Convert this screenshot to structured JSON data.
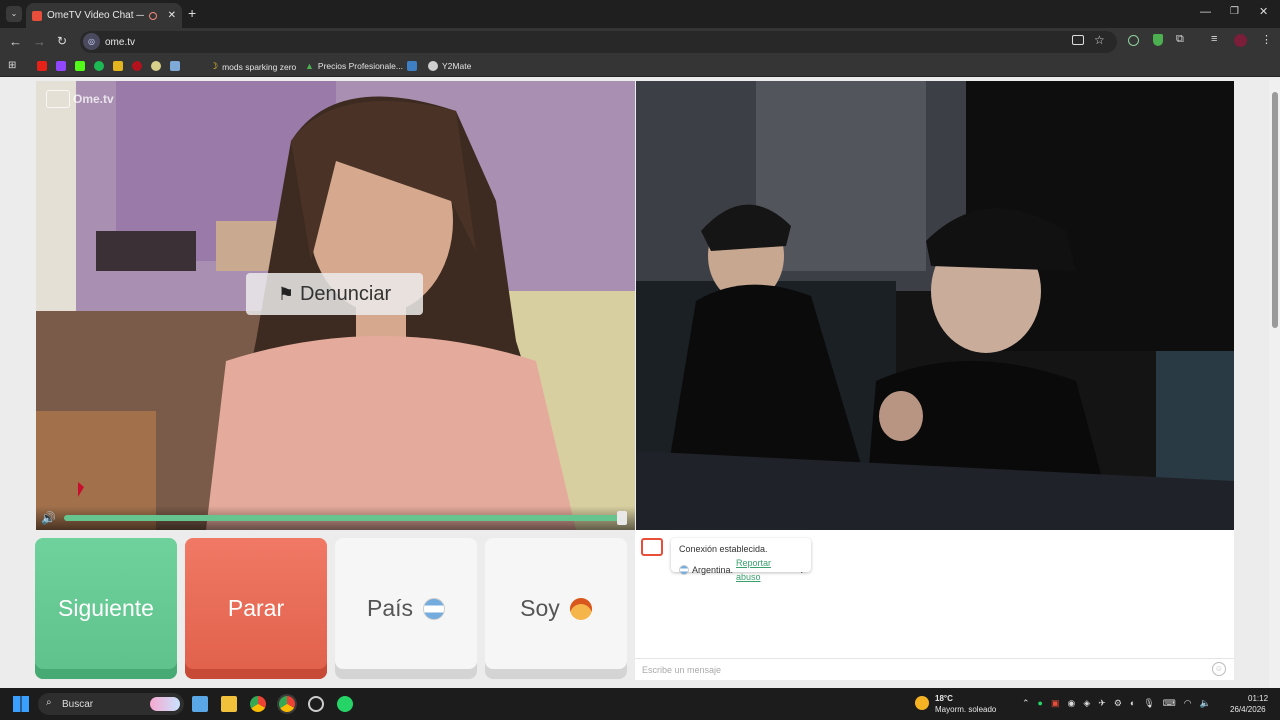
{
  "browser": {
    "tab_title": "OmeTV Video Chat — Ome",
    "url": "ome.tv",
    "bookmarks": [
      {
        "label": "mods sparking zero",
        "icon": "banana-icon",
        "color": "#f3c623"
      },
      {
        "label": "Precios Profesionale...",
        "icon": "drive-icon",
        "color": "#4caf50"
      },
      {
        "label": "Y2Mate",
        "icon": "y2mate-icon",
        "color": "#cfcfcf"
      }
    ]
  },
  "video": {
    "watermark": "Ome.tv",
    "report_label": "Denunciar"
  },
  "buttons": {
    "next": "Siguiente",
    "stop": "Parar",
    "country": "País",
    "gender": "Soy"
  },
  "chat": {
    "connection_text": "Conexión establecida.",
    "country": "Argentina.",
    "report_link": "Reportar abuso",
    "period": ".",
    "placeholder": "Escribe un mensaje"
  },
  "taskbar": {
    "search_label": "Buscar",
    "weather_temp": "18°C",
    "weather_desc": "Mayorm. soleado",
    "time": "01:12",
    "date": "26/4/2026"
  },
  "colors": {
    "next_green": "#5ec08a",
    "stop_red": "#e0604a",
    "slider_green": "#66c48f",
    "browser_dark": "#353535"
  }
}
